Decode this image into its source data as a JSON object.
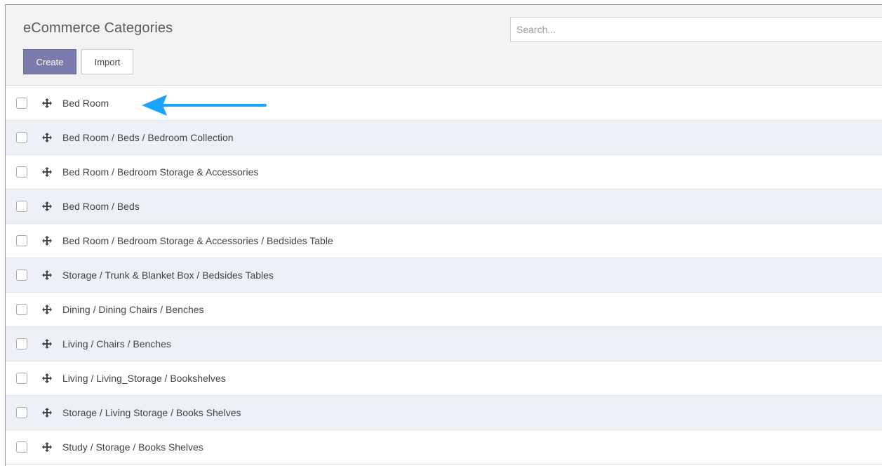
{
  "header": {
    "title": "eCommerce Categories",
    "search_placeholder": "Search...",
    "create_label": "Create",
    "import_label": "Import"
  },
  "icons": {
    "drag_handle": "drag-handle-icon",
    "annotation_arrow": "arrow-left-icon"
  },
  "colors": {
    "primary": "#7c7bad",
    "row_alt": "#eef0f7",
    "arrow": "#1aa3ff"
  },
  "rows": [
    {
      "label": "Bed Room"
    },
    {
      "label": "Bed Room / Beds / Bedroom Collection"
    },
    {
      "label": "Bed Room / Bedroom Storage & Accessories"
    },
    {
      "label": "Bed Room / Beds"
    },
    {
      "label": "Bed Room / Bedroom Storage & Accessories / Bedsides Table"
    },
    {
      "label": "Storage / Trunk & Blanket Box / Bedsides Tables"
    },
    {
      "label": "Dining / Dining Chairs / Benches"
    },
    {
      "label": "Living / Chairs / Benches"
    },
    {
      "label": "Living / Living_Storage / Bookshelves"
    },
    {
      "label": "Storage / Living Storage / Books Shelves"
    },
    {
      "label": "Study / Storage / Books Shelves"
    }
  ]
}
